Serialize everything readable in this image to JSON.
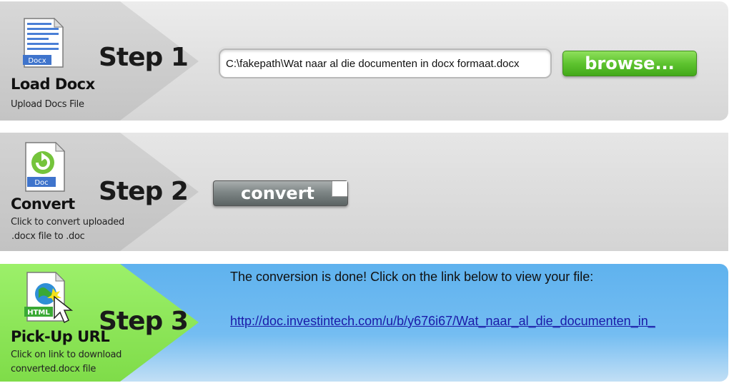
{
  "step1": {
    "icon_label": "Docx",
    "title": "Load Docx",
    "subtitle": "Upload Docs File",
    "step_label": "Step 1",
    "file_value": "C:\\fakepath\\Wat naar al die documenten in docx formaat.docx",
    "browse_label": "browse..."
  },
  "step2": {
    "icon_label": "Doc",
    "title": "Convert",
    "subtitle_line1": "Click to convert uploaded",
    "subtitle_line2": ".docx file to .doc",
    "step_label": "Step 2",
    "convert_label": "convert"
  },
  "step3": {
    "icon_label": "HTML",
    "title": "Pick-Up URL",
    "subtitle_line1": "Click on link to download",
    "subtitle_line2": "converted.docx file",
    "step_label": "Step 3",
    "message": "The conversion is done! Click on the link below to view your file:",
    "link_text": "http://doc.investintech.com/u/b/y676i67/Wat_naar_al_die_documenten_in_"
  },
  "colors": {
    "step1_arrow": "#cfcfcf",
    "step2_arrow": "#cfcfcf",
    "step3_arrow": "#8ee85a",
    "browse_green": "#5ec32f",
    "convert_gray": "#7e8686",
    "link_blue": "#1a1aa8"
  },
  "icons": {
    "step1": "docx-file-icon",
    "step2": "doc-refresh-icon",
    "step3": "html-globe-cursor-icon"
  }
}
